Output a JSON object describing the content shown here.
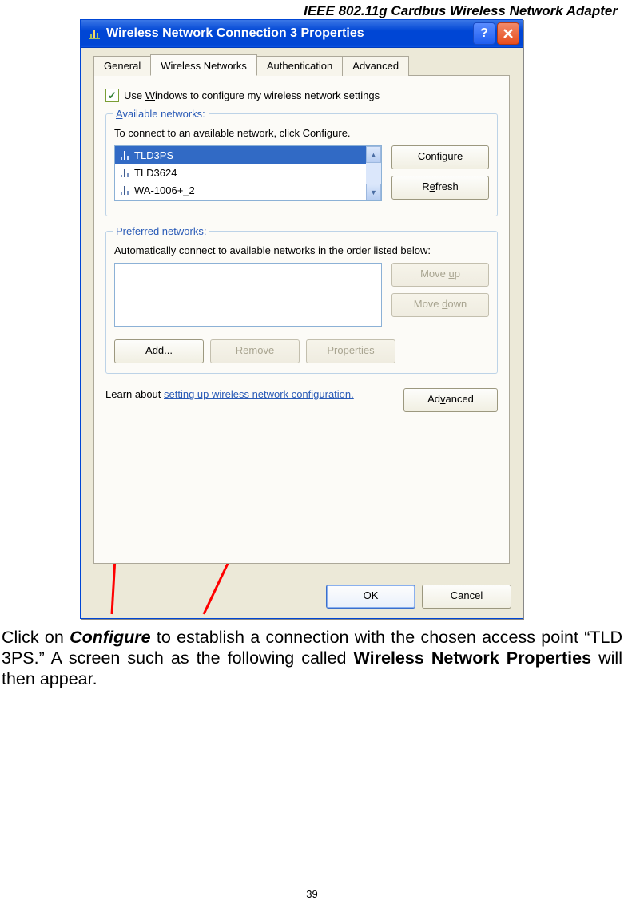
{
  "header": "IEEE 802.11g Cardbus Wireless Network Adapter",
  "window": {
    "title": "Wireless Network Connection 3 Properties"
  },
  "tabs": {
    "general": "General",
    "wireless": "Wireless Networks",
    "auth": "Authentication",
    "advanced": "Advanced"
  },
  "useWindows": "Use Windows to configure my wireless network settings",
  "available": {
    "legend": "Available networks:",
    "instruction": "To connect to an available network, click Configure.",
    "items": [
      "TLD3PS",
      "TLD3624",
      "WA-1006+_2"
    ],
    "configure": "Configure",
    "refresh": "Refresh"
  },
  "preferred": {
    "legend": "Preferred networks:",
    "instruction": "Automatically connect to available networks in the order listed below:",
    "moveup": "Move up",
    "movedown": "Move down",
    "add": "Add...",
    "remove": "Remove",
    "properties": "Properties"
  },
  "learn": {
    "prefix": "Learn about ",
    "link": "setting up wireless network configuration.",
    "advanced": "Advanced"
  },
  "dialogButtons": {
    "ok": "OK",
    "cancel": "Cancel"
  },
  "paragraph": {
    "p1a": "Click on ",
    "p1b": "Configure",
    "p1c": " to establish a connection with the chosen access point “TLD 3PS.” A screen such as the following called ",
    "p1d": "Wireless Network Properties",
    "p1e": " will then appear."
  },
  "pageNumber": "39"
}
